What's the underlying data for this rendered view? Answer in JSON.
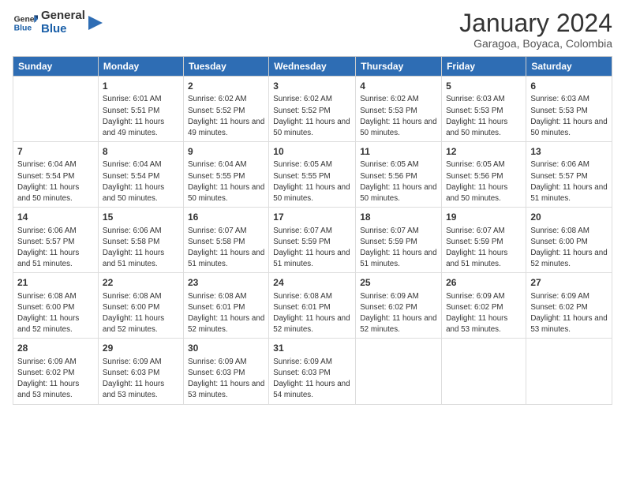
{
  "logo": {
    "line1": "General",
    "line2": "Blue"
  },
  "title": "January 2024",
  "subtitle": "Garagoa, Boyaca, Colombia",
  "weekdays": [
    "Sunday",
    "Monday",
    "Tuesday",
    "Wednesday",
    "Thursday",
    "Friday",
    "Saturday"
  ],
  "weeks": [
    [
      {
        "num": "",
        "sunrise": "",
        "sunset": "",
        "daylight": ""
      },
      {
        "num": "1",
        "sunrise": "Sunrise: 6:01 AM",
        "sunset": "Sunset: 5:51 PM",
        "daylight": "Daylight: 11 hours and 49 minutes."
      },
      {
        "num": "2",
        "sunrise": "Sunrise: 6:02 AM",
        "sunset": "Sunset: 5:52 PM",
        "daylight": "Daylight: 11 hours and 49 minutes."
      },
      {
        "num": "3",
        "sunrise": "Sunrise: 6:02 AM",
        "sunset": "Sunset: 5:52 PM",
        "daylight": "Daylight: 11 hours and 50 minutes."
      },
      {
        "num": "4",
        "sunrise": "Sunrise: 6:02 AM",
        "sunset": "Sunset: 5:53 PM",
        "daylight": "Daylight: 11 hours and 50 minutes."
      },
      {
        "num": "5",
        "sunrise": "Sunrise: 6:03 AM",
        "sunset": "Sunset: 5:53 PM",
        "daylight": "Daylight: 11 hours and 50 minutes."
      },
      {
        "num": "6",
        "sunrise": "Sunrise: 6:03 AM",
        "sunset": "Sunset: 5:53 PM",
        "daylight": "Daylight: 11 hours and 50 minutes."
      }
    ],
    [
      {
        "num": "7",
        "sunrise": "Sunrise: 6:04 AM",
        "sunset": "Sunset: 5:54 PM",
        "daylight": "Daylight: 11 hours and 50 minutes."
      },
      {
        "num": "8",
        "sunrise": "Sunrise: 6:04 AM",
        "sunset": "Sunset: 5:54 PM",
        "daylight": "Daylight: 11 hours and 50 minutes."
      },
      {
        "num": "9",
        "sunrise": "Sunrise: 6:04 AM",
        "sunset": "Sunset: 5:55 PM",
        "daylight": "Daylight: 11 hours and 50 minutes."
      },
      {
        "num": "10",
        "sunrise": "Sunrise: 6:05 AM",
        "sunset": "Sunset: 5:55 PM",
        "daylight": "Daylight: 11 hours and 50 minutes."
      },
      {
        "num": "11",
        "sunrise": "Sunrise: 6:05 AM",
        "sunset": "Sunset: 5:56 PM",
        "daylight": "Daylight: 11 hours and 50 minutes."
      },
      {
        "num": "12",
        "sunrise": "Sunrise: 6:05 AM",
        "sunset": "Sunset: 5:56 PM",
        "daylight": "Daylight: 11 hours and 50 minutes."
      },
      {
        "num": "13",
        "sunrise": "Sunrise: 6:06 AM",
        "sunset": "Sunset: 5:57 PM",
        "daylight": "Daylight: 11 hours and 51 minutes."
      }
    ],
    [
      {
        "num": "14",
        "sunrise": "Sunrise: 6:06 AM",
        "sunset": "Sunset: 5:57 PM",
        "daylight": "Daylight: 11 hours and 51 minutes."
      },
      {
        "num": "15",
        "sunrise": "Sunrise: 6:06 AM",
        "sunset": "Sunset: 5:58 PM",
        "daylight": "Daylight: 11 hours and 51 minutes."
      },
      {
        "num": "16",
        "sunrise": "Sunrise: 6:07 AM",
        "sunset": "Sunset: 5:58 PM",
        "daylight": "Daylight: 11 hours and 51 minutes."
      },
      {
        "num": "17",
        "sunrise": "Sunrise: 6:07 AM",
        "sunset": "Sunset: 5:59 PM",
        "daylight": "Daylight: 11 hours and 51 minutes."
      },
      {
        "num": "18",
        "sunrise": "Sunrise: 6:07 AM",
        "sunset": "Sunset: 5:59 PM",
        "daylight": "Daylight: 11 hours and 51 minutes."
      },
      {
        "num": "19",
        "sunrise": "Sunrise: 6:07 AM",
        "sunset": "Sunset: 5:59 PM",
        "daylight": "Daylight: 11 hours and 51 minutes."
      },
      {
        "num": "20",
        "sunrise": "Sunrise: 6:08 AM",
        "sunset": "Sunset: 6:00 PM",
        "daylight": "Daylight: 11 hours and 52 minutes."
      }
    ],
    [
      {
        "num": "21",
        "sunrise": "Sunrise: 6:08 AM",
        "sunset": "Sunset: 6:00 PM",
        "daylight": "Daylight: 11 hours and 52 minutes."
      },
      {
        "num": "22",
        "sunrise": "Sunrise: 6:08 AM",
        "sunset": "Sunset: 6:00 PM",
        "daylight": "Daylight: 11 hours and 52 minutes."
      },
      {
        "num": "23",
        "sunrise": "Sunrise: 6:08 AM",
        "sunset": "Sunset: 6:01 PM",
        "daylight": "Daylight: 11 hours and 52 minutes."
      },
      {
        "num": "24",
        "sunrise": "Sunrise: 6:08 AM",
        "sunset": "Sunset: 6:01 PM",
        "daylight": "Daylight: 11 hours and 52 minutes."
      },
      {
        "num": "25",
        "sunrise": "Sunrise: 6:09 AM",
        "sunset": "Sunset: 6:02 PM",
        "daylight": "Daylight: 11 hours and 52 minutes."
      },
      {
        "num": "26",
        "sunrise": "Sunrise: 6:09 AM",
        "sunset": "Sunset: 6:02 PM",
        "daylight": "Daylight: 11 hours and 53 minutes."
      },
      {
        "num": "27",
        "sunrise": "Sunrise: 6:09 AM",
        "sunset": "Sunset: 6:02 PM",
        "daylight": "Daylight: 11 hours and 53 minutes."
      }
    ],
    [
      {
        "num": "28",
        "sunrise": "Sunrise: 6:09 AM",
        "sunset": "Sunset: 6:02 PM",
        "daylight": "Daylight: 11 hours and 53 minutes."
      },
      {
        "num": "29",
        "sunrise": "Sunrise: 6:09 AM",
        "sunset": "Sunset: 6:03 PM",
        "daylight": "Daylight: 11 hours and 53 minutes."
      },
      {
        "num": "30",
        "sunrise": "Sunrise: 6:09 AM",
        "sunset": "Sunset: 6:03 PM",
        "daylight": "Daylight: 11 hours and 53 minutes."
      },
      {
        "num": "31",
        "sunrise": "Sunrise: 6:09 AM",
        "sunset": "Sunset: 6:03 PM",
        "daylight": "Daylight: 11 hours and 54 minutes."
      },
      {
        "num": "",
        "sunrise": "",
        "sunset": "",
        "daylight": ""
      },
      {
        "num": "",
        "sunrise": "",
        "sunset": "",
        "daylight": ""
      },
      {
        "num": "",
        "sunrise": "",
        "sunset": "",
        "daylight": ""
      }
    ]
  ]
}
